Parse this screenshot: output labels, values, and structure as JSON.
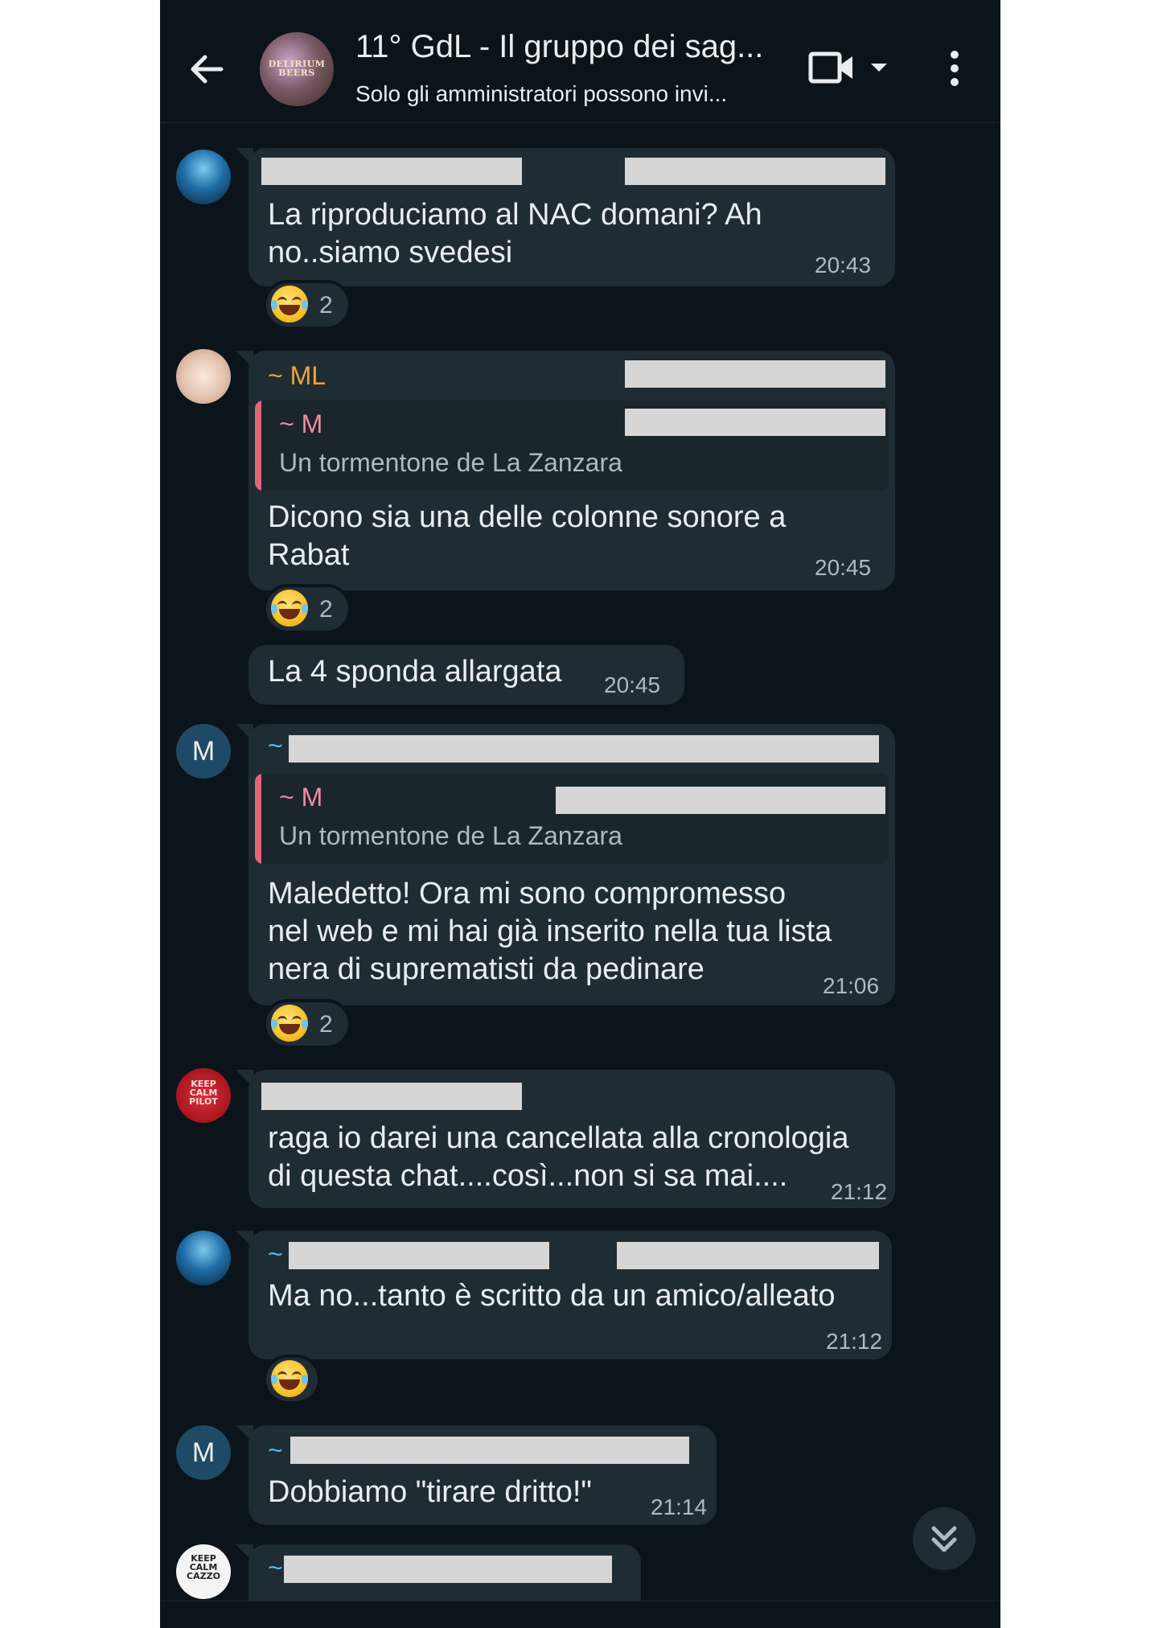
{
  "header": {
    "title": "11° GdL - Il gruppo dei sag...",
    "subtitle": "Solo gli amministratori possono invi...",
    "avatar_text": "DELIRIUM BEERS",
    "icons": [
      "back-arrow-icon",
      "video-call-icon",
      "chevron-down-icon",
      "more-vert-icon"
    ]
  },
  "messages": [
    {
      "text_lines": [
        "La riproduciamo al NAC domani? Ah",
        "no..siamo svedesi"
      ],
      "time": "20:43",
      "reaction_count": "2"
    },
    {
      "sender": "~ ML",
      "quote_sender": "~ M",
      "quote_text": "Un tormentone de La Zanzara",
      "text_lines": [
        "Dicono sia una delle colonne sonore a",
        "Rabat"
      ],
      "time": "20:45",
      "reaction_count": "2"
    },
    {
      "text_lines": [
        "La 4 sponda allargata"
      ],
      "time": "20:45"
    },
    {
      "avatar_letter": "M",
      "sender": "~",
      "quote_sender": "~ M",
      "quote_text": "Un tormentone de La Zanzara",
      "text_lines": [
        "Maledetto! Ora mi sono compromesso",
        "nel web e mi hai già inserito nella tua lista",
        "nera di suprematisti da pedinare"
      ],
      "time": "21:06",
      "reaction_count": "2"
    },
    {
      "avatar_text": "KEEP CALM PILOT",
      "text_lines": [
        "raga io darei una cancellata alla cronologia",
        "di questa chat....così...non si sa mai...."
      ],
      "time": "21:12"
    },
    {
      "sender": "~",
      "text_lines": [
        "Ma no...tanto è scritto da un amico/alleato"
      ],
      "time": "21:12"
    },
    {
      "avatar_letter": "M",
      "sender": "~",
      "text_lines": [
        "Dobbiamo \"tirare dritto!\""
      ],
      "time": "21:14"
    },
    {
      "avatar_text": "KEEP CALM CAZZO",
      "sender": "~"
    }
  ],
  "colors": {
    "background": "#0b141a",
    "bubble": "#1f2c34",
    "sender_orange": "#f0a33a",
    "sender_blue": "#53bdeb",
    "quote_bar": "#e36678",
    "redaction": "#d6d6d6"
  },
  "reaction_emoji": "face-with-tears-of-joy-icon",
  "scroll_button_icon": "double-chevron-down-icon"
}
